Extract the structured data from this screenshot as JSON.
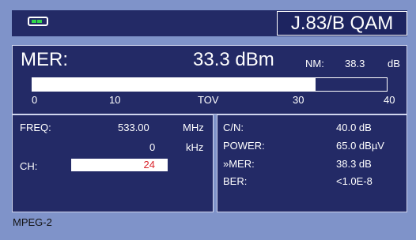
{
  "header": {
    "title": "J.83/B QAM",
    "battery_icon": "battery-icon",
    "battery_color": "#31d84a"
  },
  "mer": {
    "label": "MER:",
    "value": "33.3 dBm",
    "nm_label": "NM:",
    "nm_value": "38.3",
    "nm_unit": "dB",
    "bar_value": 0.8,
    "scale": {
      "left": "0",
      "t1": "10",
      "center": "TOV",
      "t3": "30",
      "right": "40"
    }
  },
  "left": {
    "freq_label": "FREQ:",
    "freq_value": "533.00",
    "freq_unit": "MHz",
    "offset_value": "0",
    "offset_unit": "kHz",
    "ch_label": "CH:",
    "ch_value": "24"
  },
  "right": {
    "cn_label": "C/N:",
    "cn_value": "40.0 dB",
    "power_label": "POWER:",
    "power_value": "65.0 dBµV",
    "mer_label": "»MER:",
    "mer_value": "38.3 dB",
    "ber_label": "BER:",
    "ber_value": "<1.0E-8"
  },
  "status": {
    "text": "MPEG-2"
  },
  "colors": {
    "panel": "#232a66",
    "background": "#7f93c9",
    "accent": "#d9232b"
  }
}
